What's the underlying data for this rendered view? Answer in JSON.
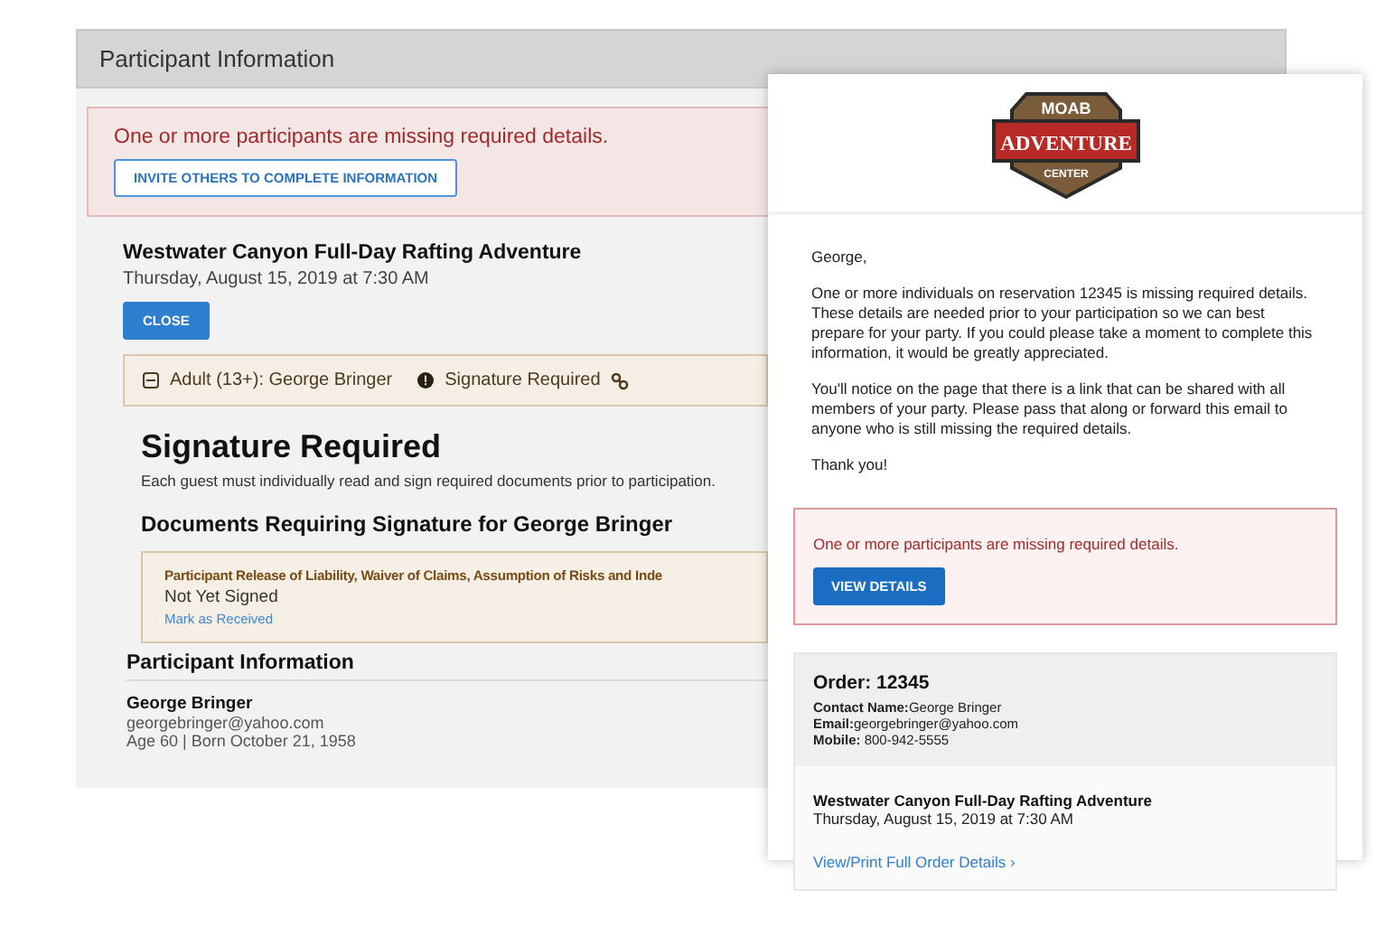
{
  "back_panel": {
    "title": "Participant Information",
    "alert": {
      "message": "One or more participants are missing required details.",
      "button": "INVITE OTHERS TO COMPLETE INFORMATION"
    },
    "trip": {
      "name": "Westwater Canyon Full-Day Rafting Adventure",
      "date": "Thursday, August 15, 2019 at 7:30 AM",
      "button": "CLOSE"
    },
    "guest": {
      "expanded": true,
      "label": "Adult (13+): George Bringer",
      "status": "Signature Required",
      "heading": "Signature Required",
      "note": "Each guest must individually read and sign required documents prior to participation.",
      "documents_heading": "Documents Requiring Signature for George Bringer",
      "documents": [
        {
          "title": "Participant Release of Liability, Waiver of Claims, Assumption of Risks and Inde",
          "status": "Not Yet Signed",
          "link": "Mark as Received"
        }
      ],
      "info_heading": "Participant Information",
      "name": "George Bringer",
      "email": "georgebringer@yahoo.com",
      "age": "Age 60 | Born October 21, 1958"
    }
  },
  "email": {
    "logo": {
      "top": "MOAB",
      "middle": "ADVENTURE",
      "bottom": "CENTER"
    },
    "greeting": "George,",
    "paragraphs": [
      "One or more individuals on reservation 12345 is missing required details. These details are needed prior to your participation so we can best prepare for your party. If you could please take a moment to complete this information, it would be greatly appreciated.",
      "You'll notice on the page that there is a link that can be shared with all members of your party. Please pass that along or forward this email to anyone who is still missing the required details.",
      "Thank you!"
    ],
    "alert": {
      "message": "One or more participants are missing required details.",
      "button": "VIEW DETAILS"
    },
    "order": {
      "title": "Order: 12345",
      "fields": [
        {
          "label": "Contact Name:",
          "value": "George Bringer"
        },
        {
          "label": "Email:",
          "value": "georgebringer@yahoo.com"
        },
        {
          "label": "Mobile:",
          "value": " 800-942-5555"
        }
      ],
      "trip_name": "Westwater Canyon Full-Day Rafting Adventure",
      "trip_date": "Thursday, August 15, 2019 at 7:30 AM",
      "link": "View/Print Full Order Details ›"
    }
  }
}
